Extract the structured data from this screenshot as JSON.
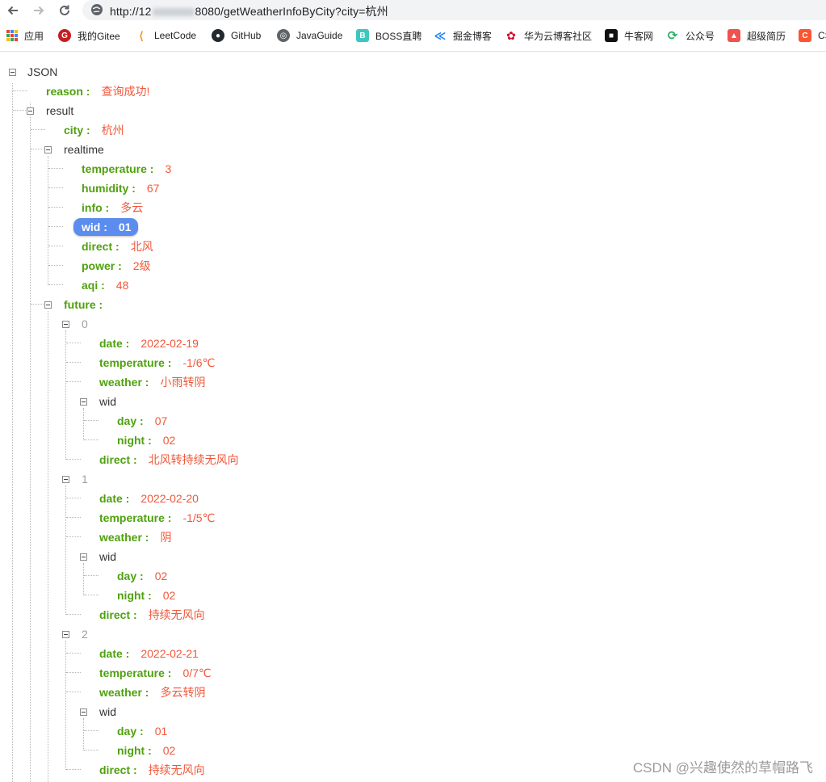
{
  "browser": {
    "url_prefix": "http://12",
    "url_suffix": "8080/getWeatherInfoByCity?city=杭州",
    "bookmarks": [
      {
        "label": "应用",
        "icon": "apps-grid-icon"
      },
      {
        "label": "我的Gitee",
        "icon": "gitee-icon",
        "color": "#c71d23"
      },
      {
        "label": "LeetCode",
        "icon": "leetcode-icon",
        "color": "#f0a134"
      },
      {
        "label": "GitHub",
        "icon": "github-icon",
        "color": "#24292e"
      },
      {
        "label": "JavaGuide",
        "icon": "globe-icon",
        "color": "#5f6368"
      },
      {
        "label": "BOSS直聘",
        "icon": "boss-icon",
        "color": "#3ec6c0"
      },
      {
        "label": "掘金博客",
        "icon": "juejin-icon",
        "color": "#1e80ff"
      },
      {
        "label": "华为云博客社区",
        "icon": "huawei-icon",
        "color": "#cf0a2c"
      },
      {
        "label": "牛客网",
        "icon": "nowcoder-icon",
        "color": "#111111"
      },
      {
        "label": "公众号",
        "icon": "wechat-icon",
        "color": "#2aae67"
      },
      {
        "label": "超级简历",
        "icon": "resume-icon",
        "color": "#ef5350"
      },
      {
        "label": "CS",
        "icon": "csdn-icon",
        "color": "#fc5531"
      }
    ]
  },
  "tree": {
    "root": "JSON",
    "reason": {
      "key": "reason :",
      "value": "查询成功!"
    },
    "result_label": "result",
    "city": {
      "key": "city :",
      "value": "杭州"
    },
    "realtime_label": "realtime",
    "realtime": [
      {
        "key": "temperature :",
        "value": "3"
      },
      {
        "key": "humidity :",
        "value": "67"
      },
      {
        "key": "info :",
        "value": "多云"
      },
      {
        "key": "wid :",
        "value": "01"
      },
      {
        "key": "direct :",
        "value": "北风"
      },
      {
        "key": "power :",
        "value": "2级"
      },
      {
        "key": "aqi :",
        "value": "48"
      }
    ],
    "future_label": "future :",
    "wid_label": "wid",
    "future": [
      {
        "index": "0",
        "date": {
          "key": "date :",
          "value": "2022-02-19"
        },
        "temperature": {
          "key": "temperature :",
          "value": "-1/6℃"
        },
        "weather": {
          "key": "weather :",
          "value": "小雨转阴"
        },
        "day": {
          "key": "day :",
          "value": "07"
        },
        "night": {
          "key": "night :",
          "value": "02"
        },
        "direct": {
          "key": "direct :",
          "value": "北风转持续无风向"
        }
      },
      {
        "index": "1",
        "date": {
          "key": "date :",
          "value": "2022-02-20"
        },
        "temperature": {
          "key": "temperature :",
          "value": "-1/5℃"
        },
        "weather": {
          "key": "weather :",
          "value": "阴"
        },
        "day": {
          "key": "day :",
          "value": "02"
        },
        "night": {
          "key": "night :",
          "value": "02"
        },
        "direct": {
          "key": "direct :",
          "value": "持续无风向"
        }
      },
      {
        "index": "2",
        "date": {
          "key": "date :",
          "value": "2022-02-21"
        },
        "temperature": {
          "key": "temperature :",
          "value": "0/7℃"
        },
        "weather": {
          "key": "weather :",
          "value": "多云转阴"
        },
        "day": {
          "key": "day :",
          "value": "01"
        },
        "night": {
          "key": "night :",
          "value": "02"
        },
        "direct": {
          "key": "direct :",
          "value": "持续无风向"
        }
      }
    ]
  },
  "watermark": "CSDN @兴趣使然的草帽路飞"
}
